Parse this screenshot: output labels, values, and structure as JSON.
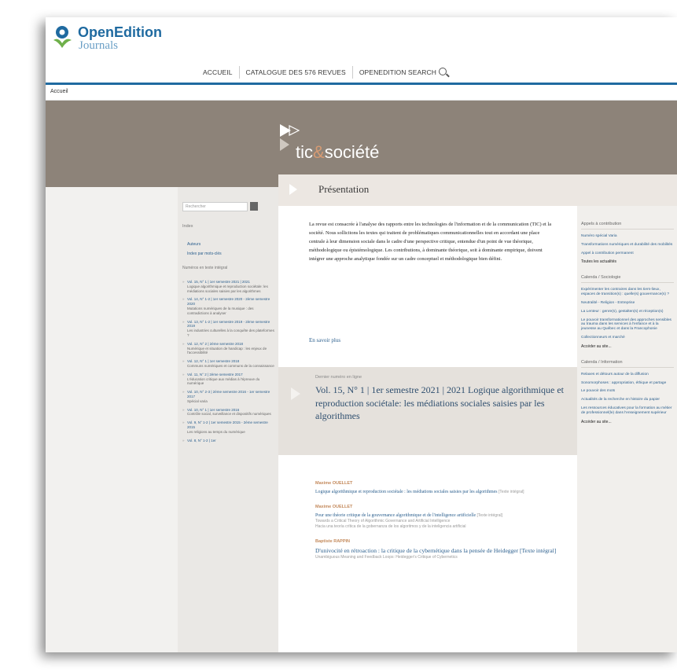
{
  "header": {
    "brand": "OpenEdition",
    "brand_sub": "Journals",
    "nav": [
      {
        "label": "ACCUEIL"
      },
      {
        "label": "CATALOGUE DES 576 REVUES"
      },
      {
        "label": "OPENEDITION SEARCH"
      }
    ]
  },
  "breadcrumb": "Accueil",
  "journal": {
    "title_a": "tic",
    "title_amp": "&",
    "title_b": "société"
  },
  "presentation": {
    "heading": "Présentation",
    "text": "La revue est consacrée à l'analyse des rapports entre les technologies de l'information et de la communication (TIC) et la société. Nous sollicitons les textes qui traitent de problématiques communicationnelles tout en accordant une place centrale à leur dimension sociale dans le cadre d'une perspective critique, entendue d'un point de vue théorique, méthodologique ou épistémologique. Les contributions, à dominante théorique, soit à dominante empirique, doivent intégrer une approche analytique fondée sur un cadre conceptuel et méthodologique bien défini.",
    "more": "En savoir plus"
  },
  "latest_issue": {
    "label": "Dernier numéro en ligne",
    "title": "Vol. 15, N° 1 | 1er semestre 2021 | 2021 Logique algorithmique et reproduction sociétale: les médiations sociales saisies par les algorithmes"
  },
  "articles": [
    {
      "author": "Maxime OUELLET",
      "title": "Logique algorithmique et reproduction sociétale : les médiations sociales saisies par les algorithmes",
      "tag": "[Texte intégral]",
      "subs": []
    },
    {
      "author": "Maxime OUELLET",
      "title": "Pour une théorie critique de la gouvernance algorithmique et de l'intelligence artificielle",
      "tag": "[Texte intégral]",
      "subs": [
        "Towards a Critical Theory of Algorithmic Governance and Artificial Intelligence",
        "Hacia una teoría crítica de la gobernanza de los algoritmos y de la inteligencia artificial"
      ]
    },
    {
      "author": "Baptiste RAPPIN",
      "title": "D'univocité en rétroaction : la critique de la cybernétique dans la pensée de Heidegger",
      "tag": "[Texte intégral]",
      "subs": [
        "Unambiguous Meaning and Feedback Loops: Heidegger's Critique of Cybernetics"
      ]
    }
  ],
  "sidebar": {
    "search_placeholder": "Rechercher",
    "index_head": "Index",
    "index_links": [
      "Auteurs",
      "Index par mots-clés"
    ],
    "issues_head": "Numéros en texte intégral",
    "issues": [
      {
        "vol": "Vol. 15, N° 1 | 1er semestre 2021 | 2021",
        "sub": "Logique algorithmique et reproduction sociétale: les médiations sociales saisies par les algorithmes"
      },
      {
        "vol": "Vol. 14, N° 1-2 | 1er semestre 2020 - 2ème semestre 2020",
        "sub": "Mutations numériques de la musique : des contradictions à analyser"
      },
      {
        "vol": "Vol. 13, N° 1-2 | 1er semestre 2019 - 2ème semestre 2019",
        "sub": "Les industries culturelles à la conquête des plateformes ?"
      },
      {
        "vol": "Vol. 12, N° 2 | 2ème semestre 2018",
        "sub": "Numérique et situation de handicap : les enjeux de l'accessibilité"
      },
      {
        "vol": "Vol. 12, N° 1 | 1er semestre 2018",
        "sub": "Communs numériques et communs de la connaissance"
      },
      {
        "vol": "Vol. 11, N° 2 | 2ème semestre 2017",
        "sub": "L'éducation critique aux médias à l'épreuve du numérique"
      },
      {
        "vol": "Vol. 10, N° 2-3 | 2ème semestre 2016 - 1er semestre 2017",
        "sub": "Spécial varia"
      },
      {
        "vol": "Vol. 10, N° 1 | 1er semestre 2016",
        "sub": "Contrôle social, surveillance et dispositifs numériques"
      },
      {
        "vol": "Vol. 9, N° 1-2 | 1er semestre 2015 - 2ème semestre 2015",
        "sub": "Les religions au temps du numérique"
      },
      {
        "vol": "Vol. 8, N° 1-2 | 1er",
        "sub": ""
      }
    ]
  },
  "right": {
    "calls_head": "Appels à contribution",
    "calls": [
      "Numéro spécial Varia",
      "Transformations numériques et durabilité des mobilités",
      "Appel à contribution permanent"
    ],
    "calls_all": "Toutes les actualités",
    "cal1_head": "Calenda / Sociologie",
    "cal1": [
      "Expérimenter les contraires dans les tiers-lieux, espaces de transition(s) : quelle(s) gouvernance(s) ?",
      "Neutralité - Religion - Entreprise",
      "La Lenteur : genre(s), gestalten(s) et réception(s)",
      "Le pouvoir transformationnel des approches sensibles au trauma dans les services à l'enfance et à la jeunesse au Québec et dans la Francophonie",
      "Collectionneurs et marché"
    ],
    "cal1_more": "Accéder au site...",
    "cal2_head": "Calenda / Information",
    "cal2": [
      "Relaxes et détours autour de la diffusion",
      "Sonomorphoses : appropriation, éthique et partage",
      "Le pouvoir des mots",
      "Actualités de la recherche en histoire du papier",
      "Les ressources éducatives pour la formation au métier de professionnel(le) dans l'enseignement supérieur"
    ],
    "cal2_more": "Accéder au site..."
  }
}
